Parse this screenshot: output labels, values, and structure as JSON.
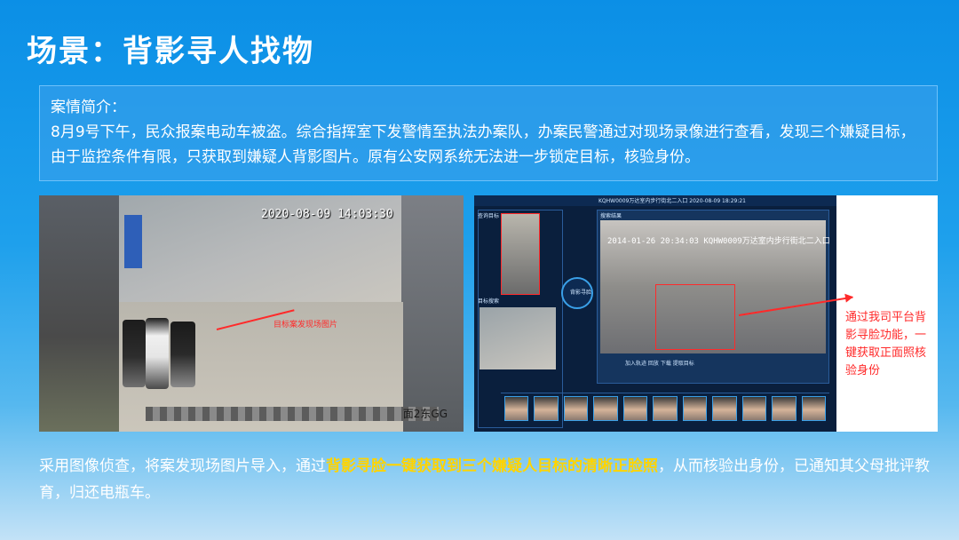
{
  "title": "场景：背影寻人找物",
  "intro": {
    "heading": "案情简介：",
    "text": "8月9号下午，民众报案电动车被盗。综合指挥室下发警情至执法办案队，办案民警通过对现场录像进行查看，发现三个嫌疑目标，由于监控条件有限，只获取到嫌疑人背影图片。原有公安网系统无法进一步锁定目标，核验身份。"
  },
  "left_photo": {
    "timestamp": "2020-08-09 14:03:30",
    "caption": "目标案发现场图片",
    "bottom_text": "面2东GG"
  },
  "right_screenshot": {
    "window_title": "KQHW0009万达室内步行街北二入口 2020-08-09 18:29:21",
    "target_label": "查询目标",
    "search_label": "目标搜索",
    "tab_label": "搜索结果",
    "circle_label": "背影寻脸",
    "video_timestamp": "2014-01-26 20:34:03",
    "video_camera": "KQHW0009万达室内步行街北二入口",
    "tools": "加入轨迹  回放  下载  提取目标",
    "face_count": 11
  },
  "note": "通过我司平台背影寻脸功能，一键获取正面照核验身份",
  "conclusion": {
    "before": "采用图像侦查，将案发现场图片导入，通过",
    "highlight": "背影寻脸一键获取到三个嫌疑人目标的清晰正脸照",
    "after": "，从而核验出身份，已通知其父母批评教育，归还电瓶车。"
  },
  "colors": {
    "title": "#ffffff",
    "highlight": "#ffd400",
    "annotation": "#ff2a2a"
  }
}
